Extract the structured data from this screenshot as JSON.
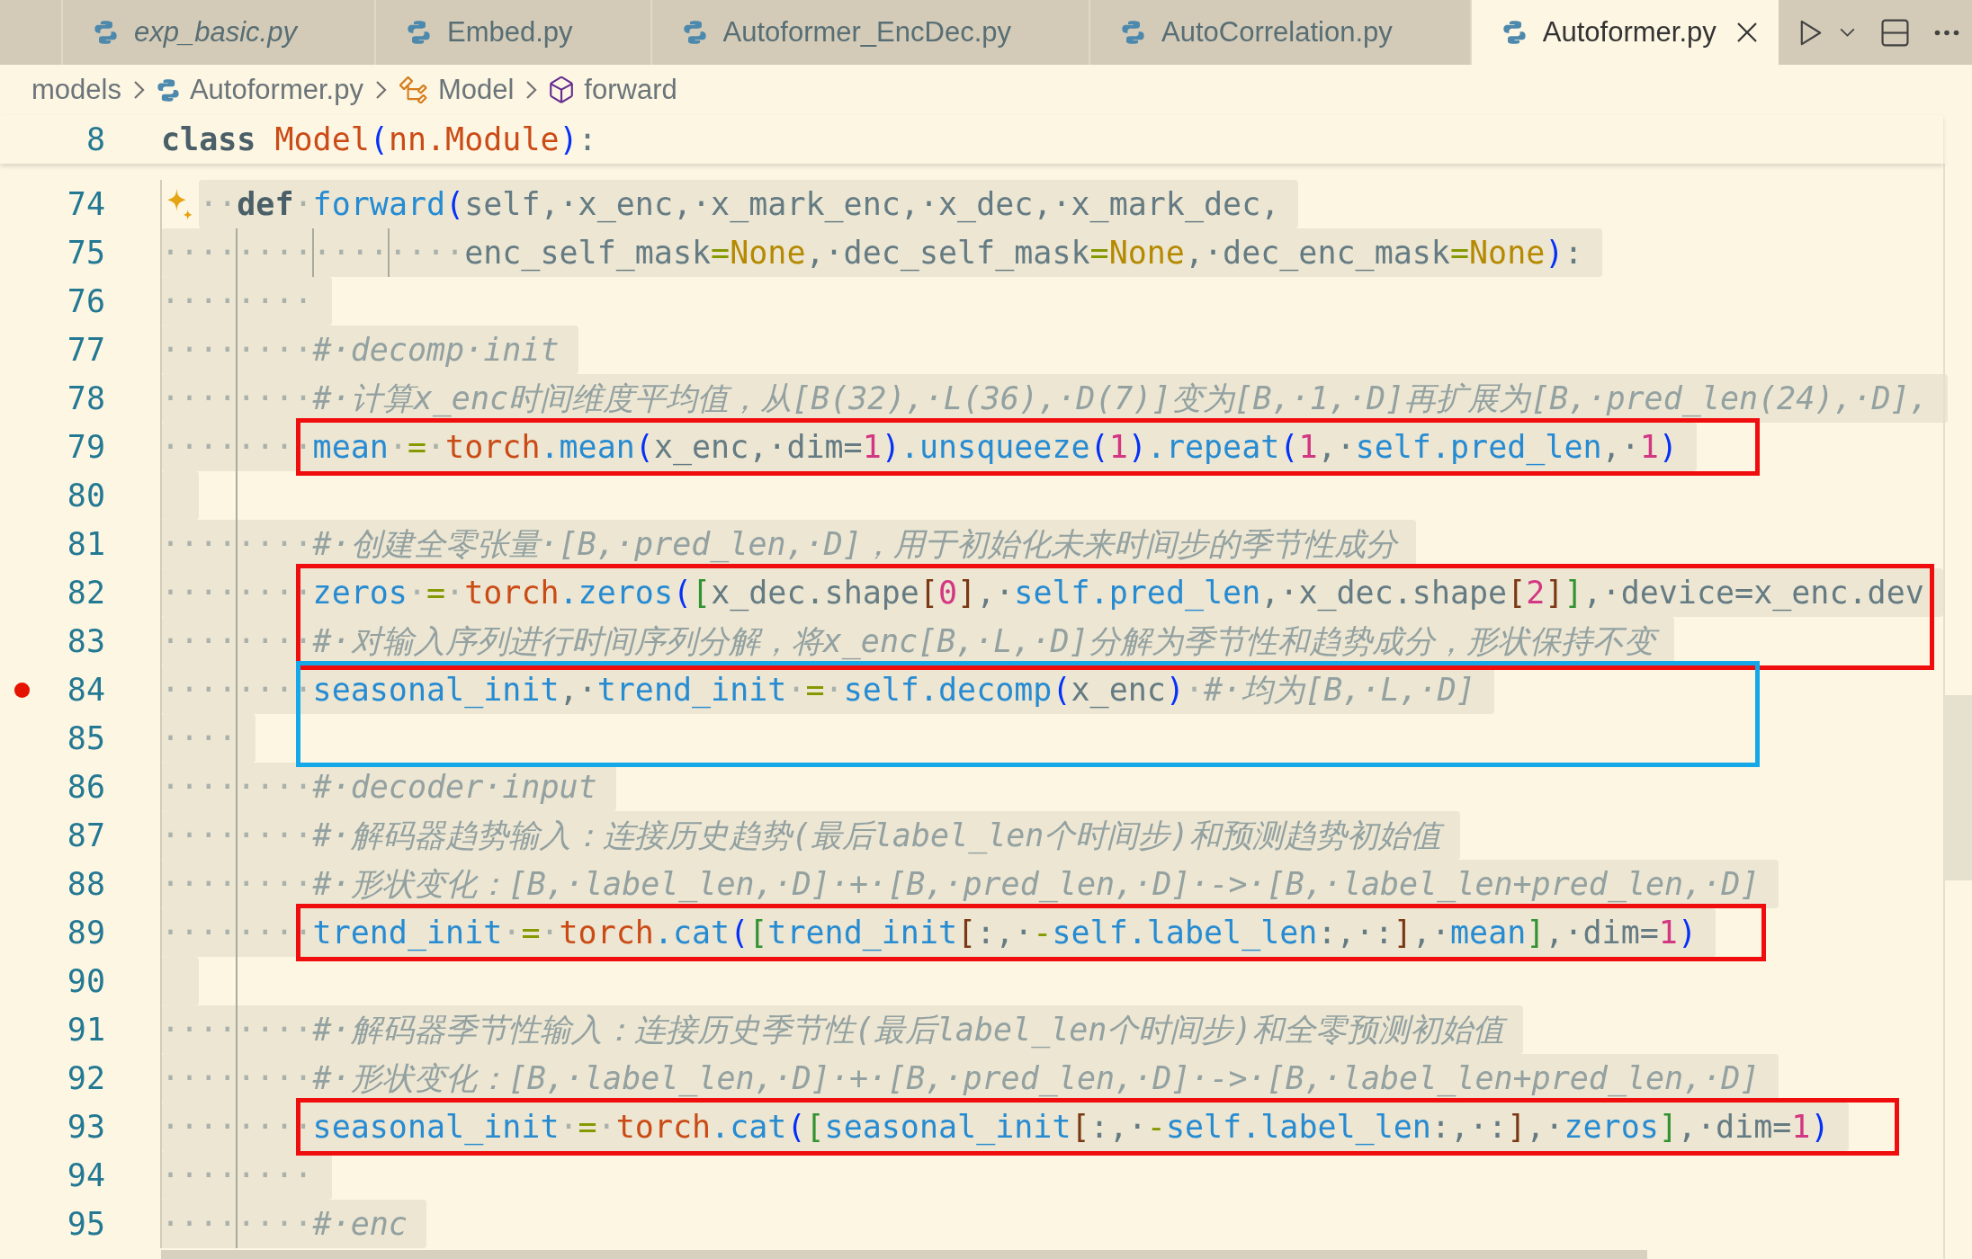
{
  "tabs": [
    {
      "label": "exp_basic.py",
      "preview": true,
      "selected": false
    },
    {
      "label": "Embed.py",
      "preview": false,
      "selected": false
    },
    {
      "label": "Autoformer_EncDec.py",
      "preview": false,
      "selected": false
    },
    {
      "label": "AutoCorrelation.py",
      "preview": false,
      "selected": false
    },
    {
      "label": "Autoformer.py",
      "preview": false,
      "selected": true
    }
  ],
  "breadcrumb": [
    {
      "kind": "folder",
      "label": "models"
    },
    {
      "kind": "file",
      "label": "Autoformer.py"
    },
    {
      "kind": "class",
      "label": "Model"
    },
    {
      "kind": "method",
      "label": "forward"
    }
  ],
  "editor": {
    "sticky_line": {
      "number": "8",
      "selected": false,
      "tokens": [
        {
          "kind": "keyword",
          "text": "class "
        },
        {
          "kind": "module",
          "text": "Model"
        },
        {
          "kind": "bracket1",
          "text": "("
        },
        {
          "kind": "module",
          "text": "nn.Module"
        },
        {
          "kind": "bracket1",
          "text": ")"
        },
        {
          "kind": "text",
          "text": ":"
        }
      ]
    },
    "code": [
      {
        "kind": "line",
        "number": "74",
        "selected": true,
        "sparkle": true,
        "tokens": [
          {
            "kind": "ws",
            "text": "··"
          },
          {
            "kind": "keyword",
            "text": "def"
          },
          {
            "kind": "ws",
            "text": "·"
          },
          {
            "kind": "name",
            "text": "forward"
          },
          {
            "kind": "bracket1",
            "text": "("
          },
          {
            "kind": "text",
            "text": "self,·x_enc,·x_mark_enc,·x_dec,·x_mark_dec,"
          }
        ]
      },
      {
        "kind": "line",
        "number": "75",
        "selected": true,
        "tokens": [
          {
            "kind": "ws",
            "text": "················"
          },
          {
            "kind": "text",
            "text": "enc_self_mask"
          },
          {
            "kind": "op",
            "text": "="
          },
          {
            "kind": "constant",
            "text": "None"
          },
          {
            "kind": "text",
            "text": ",·dec_self_mask"
          },
          {
            "kind": "op",
            "text": "="
          },
          {
            "kind": "constant",
            "text": "None"
          },
          {
            "kind": "text",
            "text": ",·dec_enc_mask"
          },
          {
            "kind": "op",
            "text": "="
          },
          {
            "kind": "constant",
            "text": "None"
          },
          {
            "kind": "bracket1",
            "text": ")"
          },
          {
            "kind": "text",
            "text": ":"
          }
        ]
      },
      {
        "kind": "line",
        "number": "76",
        "selected": true,
        "tokens": [
          {
            "kind": "ws",
            "text": "········"
          }
        ]
      },
      {
        "kind": "line",
        "number": "77",
        "selected": true,
        "tokens": [
          {
            "kind": "ws",
            "text": "········"
          },
          {
            "kind": "comment",
            "text": "#·decomp·init"
          }
        ]
      },
      {
        "kind": "line",
        "number": "78",
        "selected": true,
        "tokens": [
          {
            "kind": "ws",
            "text": "········"
          },
          {
            "kind": "comment",
            "text": "#·计算x_enc时间维度平均值，从[B(32),·L(36),·D(7)]变为[B,·1,·D]再扩展为[B,·pred_len(24),·D],"
          }
        ]
      },
      {
        "kind": "box",
        "color": "#f00d0d",
        "lines": [
          {
            "number": "79",
            "selected": true,
            "tokens": [
              {
                "kind": "ws",
                "text": "········"
              },
              {
                "kind": "name",
                "text": "mean"
              },
              {
                "kind": "ws",
                "text": "·"
              },
              {
                "kind": "op",
                "text": "="
              },
              {
                "kind": "ws",
                "text": "·"
              },
              {
                "kind": "module",
                "text": "torch"
              },
              {
                "kind": "name",
                "text": ".mean"
              },
              {
                "kind": "bracket1",
                "text": "("
              },
              {
                "kind": "text",
                "text": "x_enc,·dim="
              },
              {
                "kind": "number",
                "text": "1"
              },
              {
                "kind": "bracket1",
                "text": ")"
              },
              {
                "kind": "name",
                "text": ".unsqueeze"
              },
              {
                "kind": "bracket1",
                "text": "("
              },
              {
                "kind": "number",
                "text": "1"
              },
              {
                "kind": "bracket1",
                "text": ")"
              },
              {
                "kind": "name",
                "text": ".repeat"
              },
              {
                "kind": "bracket1",
                "text": "("
              },
              {
                "kind": "number",
                "text": "1"
              },
              {
                "kind": "text",
                "text": ",·"
              },
              {
                "kind": "name",
                "text": "self.pred_len"
              },
              {
                "kind": "text",
                "text": ",·"
              },
              {
                "kind": "number",
                "text": "1"
              },
              {
                "kind": "bracket1",
                "text": ")"
              }
            ]
          }
        ]
      },
      {
        "kind": "line",
        "number": "80",
        "selected": true
      },
      {
        "kind": "line",
        "number": "81",
        "selected": true,
        "tokens": [
          {
            "kind": "ws",
            "text": "········"
          },
          {
            "kind": "comment",
            "text": "#·创建全零张量·[B,·pred_len,·D]，用于初始化未来时间步的季节性成分"
          }
        ]
      },
      {
        "kind": "box",
        "color": "#f00d0d",
        "lines": [
          {
            "number": "82",
            "selected": true,
            "tokens": [
              {
                "kind": "ws",
                "text": "········"
              },
              {
                "kind": "name",
                "text": "zeros"
              },
              {
                "kind": "ws",
                "text": "·"
              },
              {
                "kind": "op",
                "text": "="
              },
              {
                "kind": "ws",
                "text": "·"
              },
              {
                "kind": "module",
                "text": "torch"
              },
              {
                "kind": "name",
                "text": ".zeros"
              },
              {
                "kind": "bracket1",
                "text": "("
              },
              {
                "kind": "bracket2",
                "text": "["
              },
              {
                "kind": "text",
                "text": "x_dec.shape"
              },
              {
                "kind": "bracket3",
                "text": "["
              },
              {
                "kind": "number",
                "text": "0"
              },
              {
                "kind": "bracket3",
                "text": "]"
              },
              {
                "kind": "text",
                "text": ",·"
              },
              {
                "kind": "name",
                "text": "self.pred_len"
              },
              {
                "kind": "text",
                "text": ",·x_dec.shape"
              },
              {
                "kind": "bracket3",
                "text": "["
              },
              {
                "kind": "number",
                "text": "2"
              },
              {
                "kind": "bracket3",
                "text": "]"
              },
              {
                "kind": "bracket2",
                "text": "]"
              },
              {
                "kind": "text",
                "text": ",·device=x_enc.dev"
              }
            ]
          },
          {
            "number": "83",
            "selected": true,
            "tokens": [
              {
                "kind": "ws",
                "text": "········"
              },
              {
                "kind": "comment",
                "text": "#·对输入序列进行时间序列分解，将x_enc[B,·L,·D]分解为季节性和趋势成分，形状保持不变"
              }
            ]
          }
        ]
      },
      {
        "kind": "box",
        "color": "#14a8e8",
        "lines": [
          {
            "number": "84",
            "selected": true,
            "breakpoint": true,
            "tokens": [
              {
                "kind": "ws",
                "text": "········"
              },
              {
                "kind": "name",
                "text": "seasonal_init"
              },
              {
                "kind": "text",
                "text": ",·"
              },
              {
                "kind": "name",
                "text": "trend_init"
              },
              {
                "kind": "ws",
                "text": "·"
              },
              {
                "kind": "op",
                "text": "="
              },
              {
                "kind": "ws",
                "text": "·"
              },
              {
                "kind": "name",
                "text": "self.decomp"
              },
              {
                "kind": "bracket1",
                "text": "("
              },
              {
                "kind": "text",
                "text": "x_enc"
              },
              {
                "kind": "bracket1",
                "text": ")"
              },
              {
                "kind": "ws",
                "text": "·"
              },
              {
                "kind": "comment",
                "text": "#·均为[B,·L,·D]"
              }
            ]
          },
          {
            "number": "85",
            "selected": true,
            "tokens": [
              {
                "kind": "ws",
                "text": "····"
              }
            ]
          }
        ]
      },
      {
        "kind": "line",
        "number": "86",
        "selected": true,
        "tokens": [
          {
            "kind": "ws",
            "text": "········"
          },
          {
            "kind": "comment",
            "text": "#·decoder·input"
          }
        ]
      },
      {
        "kind": "line",
        "number": "87",
        "selected": true,
        "tokens": [
          {
            "kind": "ws",
            "text": "········"
          },
          {
            "kind": "comment",
            "text": "#·解码器趋势输入：连接历史趋势(最后label_len个时间步)和预测趋势初始值"
          }
        ]
      },
      {
        "kind": "line",
        "number": "88",
        "selected": true,
        "tokens": [
          {
            "kind": "ws",
            "text": "········"
          },
          {
            "kind": "comment",
            "text": "#·形状变化：[B,·label_len,·D]·+·[B,·pred_len,·D]·->·[B,·label_len+pred_len,·D]"
          }
        ]
      },
      {
        "kind": "box",
        "color": "#f00d0d",
        "lines": [
          {
            "number": "89",
            "selected": true,
            "tokens": [
              {
                "kind": "ws",
                "text": "········"
              },
              {
                "kind": "name",
                "text": "trend_init"
              },
              {
                "kind": "ws",
                "text": "·"
              },
              {
                "kind": "op",
                "text": "="
              },
              {
                "kind": "ws",
                "text": "·"
              },
              {
                "kind": "module",
                "text": "torch"
              },
              {
                "kind": "name",
                "text": ".cat"
              },
              {
                "kind": "bracket1",
                "text": "("
              },
              {
                "kind": "bracket2",
                "text": "["
              },
              {
                "kind": "name",
                "text": "trend_init"
              },
              {
                "kind": "bracket3",
                "text": "["
              },
              {
                "kind": "text",
                "text": ":,·"
              },
              {
                "kind": "op",
                "text": "-"
              },
              {
                "kind": "name",
                "text": "self.label_len"
              },
              {
                "kind": "text",
                "text": ":,·:"
              },
              {
                "kind": "bracket3",
                "text": "]"
              },
              {
                "kind": "text",
                "text": ",·"
              },
              {
                "kind": "name",
                "text": "mean"
              },
              {
                "kind": "bracket2",
                "text": "]"
              },
              {
                "kind": "text",
                "text": ",·dim="
              },
              {
                "kind": "number",
                "text": "1"
              },
              {
                "kind": "bracket1",
                "text": ")"
              }
            ]
          }
        ]
      },
      {
        "kind": "line",
        "number": "90",
        "selected": true
      },
      {
        "kind": "line",
        "number": "91",
        "selected": true,
        "tokens": [
          {
            "kind": "ws",
            "text": "········"
          },
          {
            "kind": "comment",
            "text": "#·解码器季节性输入：连接历史季节性(最后label_len个时间步)和全零预测初始值"
          }
        ]
      },
      {
        "kind": "line",
        "number": "92",
        "selected": true,
        "tokens": [
          {
            "kind": "ws",
            "text": "········"
          },
          {
            "kind": "comment",
            "text": "#·形状变化：[B,·label_len,·D]·+·[B,·pred_len,·D]·->·[B,·label_len+pred_len,·D]"
          }
        ]
      },
      {
        "kind": "box",
        "color": "#f00d0d",
        "lines": [
          {
            "number": "93",
            "selected": true,
            "tokens": [
              {
                "kind": "ws",
                "text": "········"
              },
              {
                "kind": "name",
                "text": "seasonal_init"
              },
              {
                "kind": "ws",
                "text": "·"
              },
              {
                "kind": "op",
                "text": "="
              },
              {
                "kind": "ws",
                "text": "·"
              },
              {
                "kind": "module",
                "text": "torch"
              },
              {
                "kind": "name",
                "text": ".cat"
              },
              {
                "kind": "bracket1",
                "text": "("
              },
              {
                "kind": "bracket2",
                "text": "["
              },
              {
                "kind": "name",
                "text": "seasonal_init"
              },
              {
                "kind": "bracket3",
                "text": "["
              },
              {
                "kind": "text",
                "text": ":,·"
              },
              {
                "kind": "op",
                "text": "-"
              },
              {
                "kind": "name",
                "text": "self.label_len"
              },
              {
                "kind": "text",
                "text": ":,·:"
              },
              {
                "kind": "bracket3",
                "text": "]"
              },
              {
                "kind": "text",
                "text": ",·"
              },
              {
                "kind": "name",
                "text": "zeros"
              },
              {
                "kind": "bracket2",
                "text": "]"
              },
              {
                "kind": "text",
                "text": ",·dim="
              },
              {
                "kind": "number",
                "text": "1"
              },
              {
                "kind": "bracket1",
                "text": ")"
              }
            ]
          }
        ]
      },
      {
        "kind": "line",
        "number": "94",
        "selected": true,
        "tokens": [
          {
            "kind": "ws",
            "text": "········"
          }
        ]
      },
      {
        "kind": "line",
        "number": "95",
        "selected": true,
        "tokens": [
          {
            "kind": "ws",
            "text": "········"
          },
          {
            "kind": "comment",
            "text": "#·enc"
          }
        ]
      }
    ]
  }
}
